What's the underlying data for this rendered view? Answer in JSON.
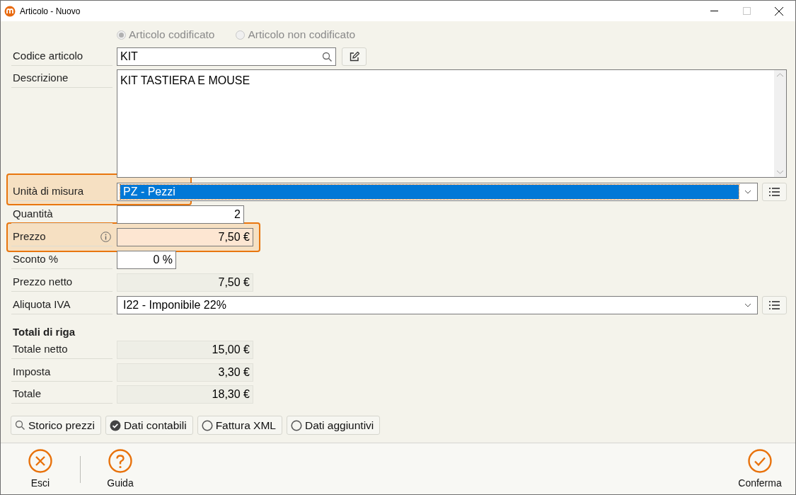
{
  "window": {
    "title": "Articolo - Nuovo"
  },
  "article_type": [
    {
      "label": "Articolo codificato",
      "selected": true,
      "disabled": true
    },
    {
      "label": "Articolo non codificato",
      "selected": false,
      "disabled": true
    }
  ],
  "fields": [
    {
      "kind": "lookup",
      "label": "Codice articolo",
      "value": "KIT",
      "highlighted": false
    },
    {
      "kind": "textarea",
      "label": "Descrizione",
      "value": "KIT TASTIERA E MOUSE",
      "highlighted": false
    },
    {
      "kind": "select",
      "label": "Unità di misura",
      "value": "PZ - Pezzi",
      "highlighted": true,
      "focused": true
    },
    {
      "kind": "quantity",
      "label": "Quantità",
      "value": "2",
      "highlighted": false
    },
    {
      "kind": "money",
      "label": "Prezzo",
      "value": "7,50 €",
      "highlighted": true,
      "info": true
    },
    {
      "kind": "percent",
      "label": "Sconto %",
      "value": "0 %",
      "highlighted": false
    },
    {
      "kind": "readonly",
      "label": "Prezzo netto",
      "value": "7,50 €",
      "highlighted": false
    },
    {
      "kind": "select",
      "label": "Aliquota IVA",
      "value": "I22 - Imponibile 22%",
      "highlighted": false,
      "focused": false
    }
  ],
  "totals": {
    "title": "Totali di riga",
    "rows": [
      {
        "label": "Totale netto",
        "value": "15,00 €"
      },
      {
        "label": "Imposta",
        "value": "3,30 €"
      },
      {
        "label": "Totale",
        "value": "18,30 €"
      }
    ]
  },
  "toggles": [
    {
      "kind": "search",
      "label": "Storico prezzi"
    },
    {
      "kind": "toggle",
      "label": "Dati contabili",
      "checked": true
    },
    {
      "kind": "toggle",
      "label": "Fattura XML",
      "checked": false
    },
    {
      "kind": "toggle",
      "label": "Dati aggiuntivi",
      "checked": false
    }
  ],
  "footer": [
    {
      "kind": "exit",
      "label": "Esci"
    },
    {
      "kind": "help",
      "label": "Guida"
    },
    {
      "kind": "confirm",
      "label": "Conferma"
    }
  ]
}
